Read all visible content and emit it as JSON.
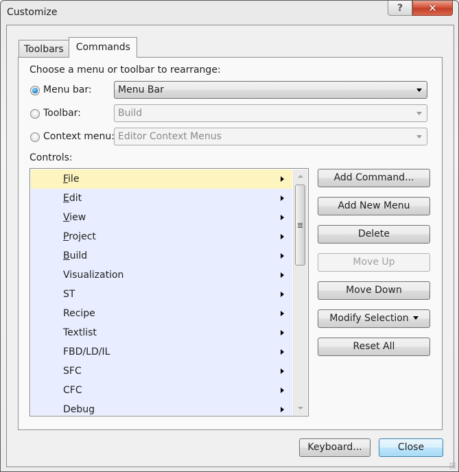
{
  "window": {
    "title": "Customize",
    "help_icon": "question-mark-icon",
    "help_glyph": "?",
    "close_icon": "close-x-icon",
    "close_glyph": "✕"
  },
  "tabs": [
    {
      "label": "Toolbars",
      "active": false
    },
    {
      "label": "Commands",
      "active": true
    }
  ],
  "commands": {
    "choose_label": "Choose a menu or toolbar to rearrange:",
    "options": [
      {
        "label": "Menu bar:",
        "checked": true,
        "combo_value": "Menu Bar",
        "enabled": true
      },
      {
        "label": "Toolbar:",
        "checked": false,
        "combo_value": "Build",
        "enabled": false
      },
      {
        "label": "Context menu:",
        "checked": false,
        "combo_value": "Editor Context Menus",
        "enabled": false
      }
    ],
    "controls_label": "Controls:",
    "controls": [
      {
        "mnemonic": "F",
        "rest": "ile",
        "selected": true
      },
      {
        "mnemonic": "E",
        "rest": "dit",
        "selected": false
      },
      {
        "mnemonic": "V",
        "rest": "iew",
        "selected": false
      },
      {
        "mnemonic": "P",
        "rest": "roject",
        "selected": false
      },
      {
        "mnemonic": "B",
        "rest": "uild",
        "selected": false
      },
      {
        "mnemonic": "",
        "rest": "Visualization",
        "selected": false
      },
      {
        "mnemonic": "",
        "rest": "ST",
        "selected": false
      },
      {
        "mnemonic": "",
        "rest": "Recipe",
        "selected": false
      },
      {
        "mnemonic": "",
        "rest": "Textlist",
        "selected": false
      },
      {
        "mnemonic": "",
        "rest": "FBD/LD/IL",
        "selected": false
      },
      {
        "mnemonic": "",
        "rest": "SFC",
        "selected": false
      },
      {
        "mnemonic": "",
        "rest": "CFC",
        "selected": false
      },
      {
        "mnemonic": "",
        "rest": "Debug",
        "selected": false
      }
    ],
    "buttons": {
      "add_command": "Add Command...",
      "add_new_menu": "Add New Menu",
      "delete": "Delete",
      "move_up": "Move Up",
      "move_down": "Move Down",
      "modify_selection": "Modify Selection",
      "reset_all": "Reset All"
    }
  },
  "footer": {
    "keyboard": "Keyboard...",
    "close": "Close"
  },
  "colors": {
    "selected_row": "#fdf4bf",
    "list_background": "#e8eeff",
    "close_caption": "#c4402a",
    "default_button_border": "#3c7fb1"
  }
}
